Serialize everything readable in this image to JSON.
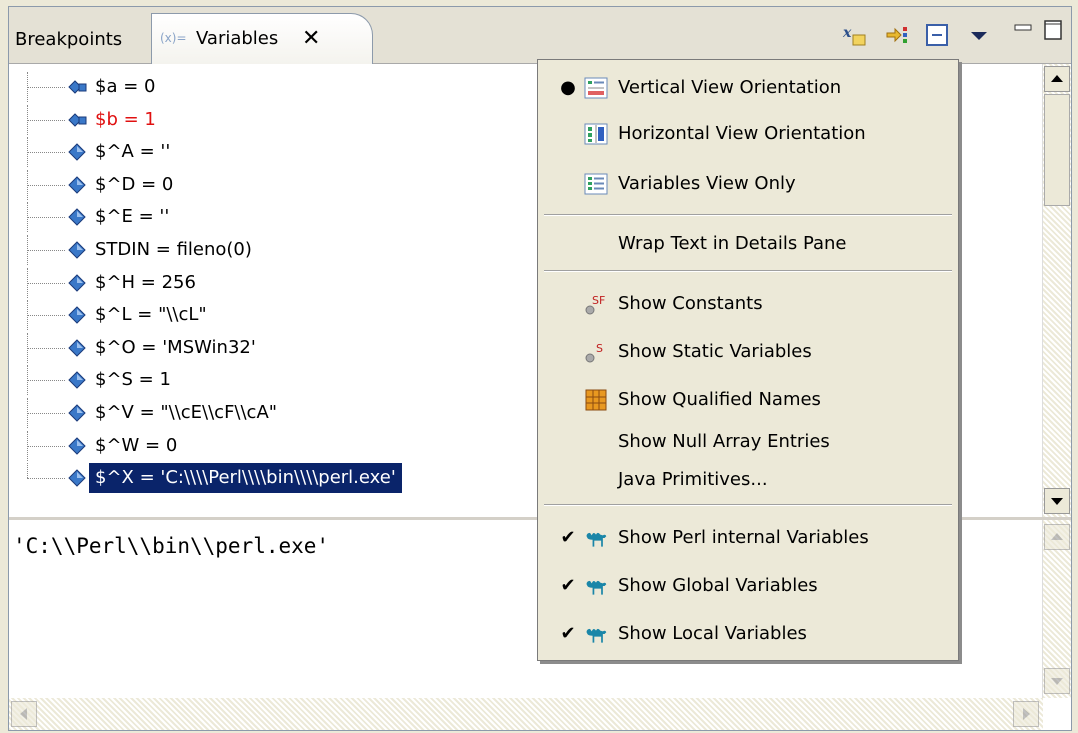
{
  "tabs": {
    "breakpoints": "Breakpoints",
    "variables": "Variables",
    "close": "✕"
  },
  "variables": [
    {
      "text": "$a = 0",
      "icon": "breakpoint-variable-icon",
      "color": "#000000"
    },
    {
      "text": "$b = 1",
      "icon": "breakpoint-variable-icon",
      "color": "#e01010"
    },
    {
      "text": "$^A = ''",
      "icon": "variable-diamond-icon",
      "color": "#000000"
    },
    {
      "text": "$^D = 0",
      "icon": "variable-diamond-icon",
      "color": "#000000"
    },
    {
      "text": "$^E = ''",
      "icon": "variable-diamond-icon",
      "color": "#000000"
    },
    {
      "text": "STDIN = fileno(0)",
      "icon": "variable-diamond-icon",
      "color": "#000000"
    },
    {
      "text": "$^H = 256",
      "icon": "variable-diamond-icon",
      "color": "#000000"
    },
    {
      "text": "$^L = \"\\\\cL\"",
      "icon": "variable-diamond-icon",
      "color": "#000000"
    },
    {
      "text": "$^O = 'MSWin32'",
      "icon": "variable-diamond-icon",
      "color": "#000000"
    },
    {
      "text": "$^S = 1",
      "icon": "variable-diamond-icon",
      "color": "#000000"
    },
    {
      "text": "$^V = \"\\\\cE\\\\cF\\\\cA\"",
      "icon": "variable-diamond-icon",
      "color": "#000000"
    },
    {
      "text": "$^W = 0",
      "icon": "variable-diamond-icon",
      "color": "#000000"
    },
    {
      "text": "$^X = 'C:\\\\\\\\Perl\\\\\\\\bin\\\\\\\\perl.exe'",
      "icon": "variable-diamond-icon",
      "color": "#000000",
      "selected": true
    }
  ],
  "detail_text": "'C:\\\\Perl\\\\bin\\\\perl.exe'",
  "menu": {
    "vertical": "Vertical View Orientation",
    "horizontal": "Horizontal View Orientation",
    "vars_only": "Variables View Only",
    "wrap": "Wrap Text in Details Pane",
    "constants": "Show Constants",
    "static": "Show Static Variables",
    "qualified": "Show Qualified Names",
    "null_array": "Show Null Array Entries",
    "java_prims": "Java Primitives...",
    "perl_internal": "Show Perl internal Variables",
    "global": "Show Global Variables",
    "local": "Show Local Variables",
    "bullet": "●",
    "check": "✔"
  },
  "colors": {
    "selection": "#0a246a",
    "camel": "#1a86a8",
    "diamond": "#3a78c8"
  }
}
